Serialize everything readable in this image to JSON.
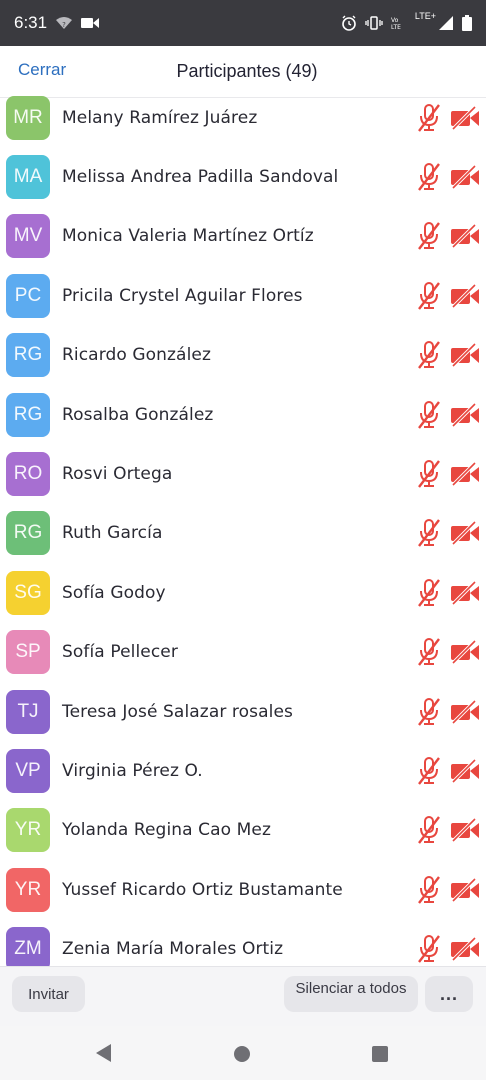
{
  "status_bar": {
    "time": "6:31",
    "network_label": "LTE+",
    "icons": [
      "wifi-icon",
      "video-camera-icon",
      "alarm-icon",
      "vibrate-icon",
      "volte-icon",
      "signal-icon",
      "battery-icon"
    ]
  },
  "header": {
    "close_label": "Cerrar",
    "title": "Participantes (49)"
  },
  "participants": [
    {
      "initials": "MR",
      "name": "Melany Ramírez Juárez",
      "color": "#8bc56a",
      "mic": "muted",
      "video": "off"
    },
    {
      "initials": "MA",
      "name": "Melissa Andrea Padilla Sandoval",
      "color": "#4fc3d9",
      "mic": "muted",
      "video": "off"
    },
    {
      "initials": "MV",
      "name": "Monica Valeria Martínez Ortíz",
      "color": "#a76fd1",
      "mic": "muted",
      "video": "off"
    },
    {
      "initials": "PC",
      "name": "Pricila Crystel Aguilar Flores",
      "color": "#5cabf0",
      "mic": "muted",
      "video": "off"
    },
    {
      "initials": "RG",
      "name": "Ricardo González",
      "color": "#5cabf0",
      "mic": "muted",
      "video": "off"
    },
    {
      "initials": "RG",
      "name": "Rosalba González",
      "color": "#5cabf0",
      "mic": "muted",
      "video": "off"
    },
    {
      "initials": "RO",
      "name": "Rosvi Ortega",
      "color": "#a76fd1",
      "mic": "muted",
      "video": "off"
    },
    {
      "initials": "RG",
      "name": "Ruth García",
      "color": "#6dbf78",
      "mic": "muted",
      "video": "off"
    },
    {
      "initials": "SG",
      "name": "Sofía Godoy",
      "color": "#f5d130",
      "mic": "muted",
      "video": "off"
    },
    {
      "initials": "SP",
      "name": "Sofía Pellecer",
      "color": "#e78ab8",
      "mic": "muted",
      "video": "off"
    },
    {
      "initials": "TJ",
      "name": "Teresa José Salazar rosales",
      "color": "#8a66cc",
      "mic": "muted",
      "video": "off"
    },
    {
      "initials": "VP",
      "name": "Virginia Pérez O.",
      "color": "#8a66cc",
      "mic": "muted",
      "video": "off"
    },
    {
      "initials": "YR",
      "name": "Yolanda Regina Cao Mez",
      "color": "#a9d86e",
      "mic": "muted",
      "video": "off"
    },
    {
      "initials": "YR",
      "name": "Yussef Ricardo Ortiz Bustamante",
      "color": "#f16666",
      "mic": "muted",
      "video": "off"
    },
    {
      "initials": "ZM",
      "name": "Zenia María Morales Ortiz",
      "color": "#8a66cc",
      "mic": "muted",
      "video": "off"
    }
  ],
  "footer": {
    "invite_label": "Invitar",
    "mute_all_label": "Silenciar a todos",
    "more_label": "..."
  },
  "colors": {
    "accent": "#2d6fbf",
    "muted_icon": "#e8473f"
  }
}
